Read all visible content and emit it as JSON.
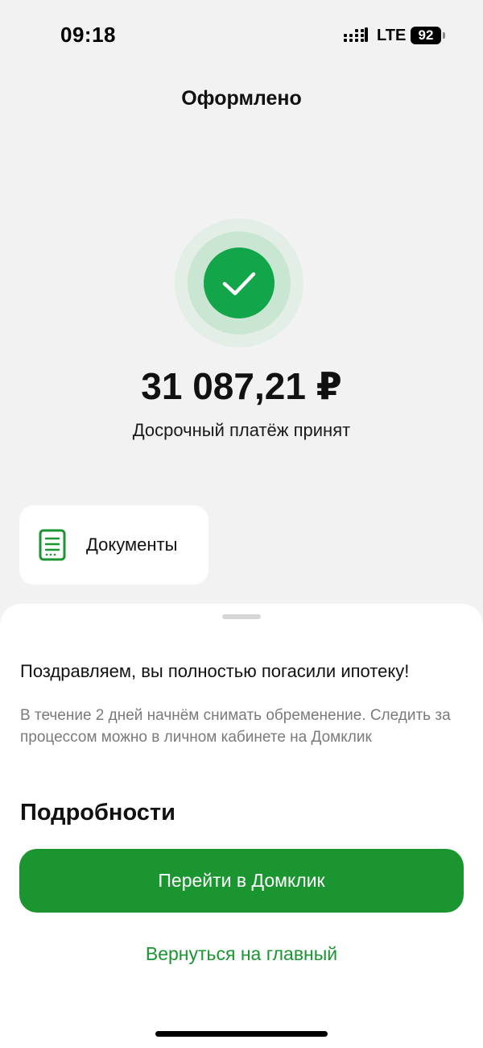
{
  "status_bar": {
    "time": "09:18",
    "network": "LTE",
    "battery_level": "92",
    "signal_icon": "signal-bars-icon"
  },
  "header": {
    "title": "Оформлено"
  },
  "result": {
    "icon": "checkmark-icon",
    "amount": "31 087,21 ₽",
    "status": "Досрочный платёж принят"
  },
  "documents": {
    "icon": "document-icon",
    "label": "Документы"
  },
  "sheet": {
    "headline": "Поздравляем, вы полностью погасили ипотеку!",
    "description": "В течение 2 дней начнём снимать обременение. Следить за процессом можно в личном кабинете на Домклик",
    "details_heading": "Подробности",
    "primary_button": "Перейти в Домклик",
    "secondary_link": "Вернуться на главный"
  },
  "colors": {
    "accent_green": "#1a9530",
    "success_green": "#12a54a",
    "background": "#f2f2f2"
  }
}
